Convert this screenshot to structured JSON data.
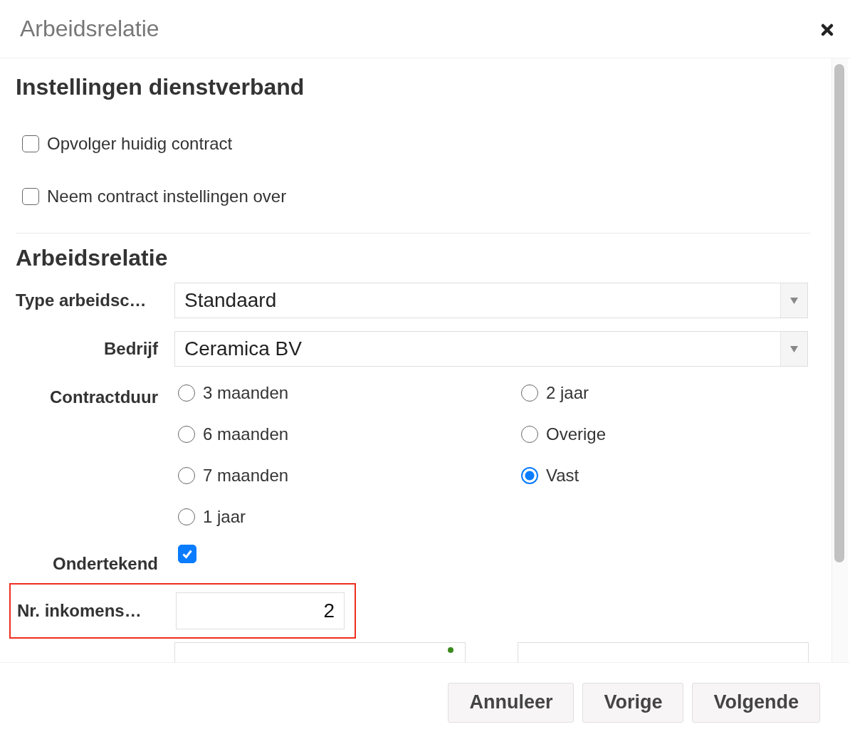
{
  "dialog": {
    "title": "Arbeidsrelatie"
  },
  "settings": {
    "heading": "Instellingen dienstverband",
    "checkboxes": [
      {
        "label": "Opvolger huidig contract",
        "checked": false
      },
      {
        "label": "Neem contract instellingen over",
        "checked": false
      }
    ]
  },
  "form": {
    "heading": "Arbeidsrelatie",
    "selects": [
      {
        "label": "Type arbeidsc…",
        "value": "Standaard"
      },
      {
        "label": "Bedrijf",
        "value": "Ceramica BV"
      }
    ],
    "duration": {
      "label": "Contractduur",
      "options": [
        {
          "label": "3 maanden",
          "selected": false
        },
        {
          "label": "6 maanden",
          "selected": false
        },
        {
          "label": "7 maanden",
          "selected": false
        },
        {
          "label": "1 jaar",
          "selected": false
        },
        {
          "label": "2 jaar",
          "selected": false
        },
        {
          "label": "Overige",
          "selected": false
        },
        {
          "label": "Vast",
          "selected": true
        }
      ]
    },
    "signed": {
      "label": "Ondertekend",
      "checked": true
    },
    "income": {
      "label": "Nr. inkomens…",
      "value": "2",
      "highlighted": true
    }
  },
  "buttons": [
    "Annuleer",
    "Vorige",
    "Volgende"
  ]
}
